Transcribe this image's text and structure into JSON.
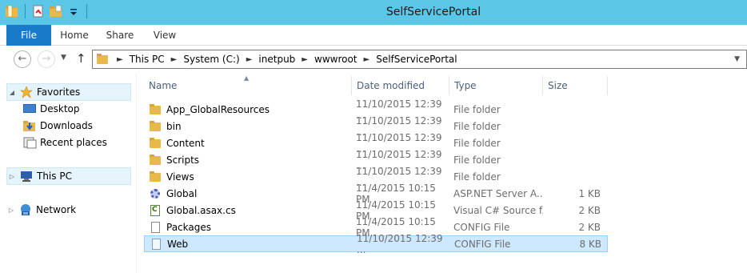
{
  "window": {
    "title": "SelfServicePortal"
  },
  "ribbon": {
    "tabs": [
      {
        "label": "File"
      },
      {
        "label": "Home"
      },
      {
        "label": "Share"
      },
      {
        "label": "View"
      }
    ]
  },
  "address": {
    "crumbs": [
      "This PC",
      "System (C:)",
      "inetpub",
      "wwwroot",
      "SelfServicePortal"
    ]
  },
  "navpane": {
    "favorites": "Favorites",
    "desktop": "Desktop",
    "downloads": "Downloads",
    "recent": "Recent places",
    "thispc": "This PC",
    "network": "Network"
  },
  "columns": {
    "name": "Name",
    "date": "Date modified",
    "type": "Type",
    "size": "Size"
  },
  "files": [
    {
      "name": "App_GlobalResources",
      "date": "11/10/2015 12:39 ...",
      "type": "File folder",
      "size": "",
      "icon": "folder-icon"
    },
    {
      "name": "bin",
      "date": "11/10/2015 12:39 ...",
      "type": "File folder",
      "size": "",
      "icon": "folder-icon"
    },
    {
      "name": "Content",
      "date": "11/10/2015 12:39 ...",
      "type": "File folder",
      "size": "",
      "icon": "folder-icon"
    },
    {
      "name": "Scripts",
      "date": "11/10/2015 12:39 ...",
      "type": "File folder",
      "size": "",
      "icon": "folder-icon"
    },
    {
      "name": "Views",
      "date": "11/10/2015 12:39 ...",
      "type": "File folder",
      "size": "",
      "icon": "folder-icon"
    },
    {
      "name": "Global",
      "date": "11/4/2015 10:15 PM",
      "type": "ASP.NET Server A...",
      "size": "1 KB",
      "icon": "aspnet-gear-icon"
    },
    {
      "name": "Global.asax.cs",
      "date": "11/4/2015 10:15 PM",
      "type": "Visual C# Source f...",
      "size": "2 KB",
      "icon": "csharp-file-icon"
    },
    {
      "name": "Packages",
      "date": "11/4/2015 10:15 PM",
      "type": "CONFIG File",
      "size": "2 KB",
      "icon": "document-icon"
    },
    {
      "name": "Web",
      "date": "11/10/2015 12:39 ...",
      "type": "CONFIG File",
      "size": "8 KB",
      "icon": "config-file-icon"
    }
  ],
  "colors": {
    "titlebar": "#5bc7e8",
    "file_tab": "#1979ca",
    "selection": "#cde8ff",
    "folder": "#e8b84a"
  }
}
